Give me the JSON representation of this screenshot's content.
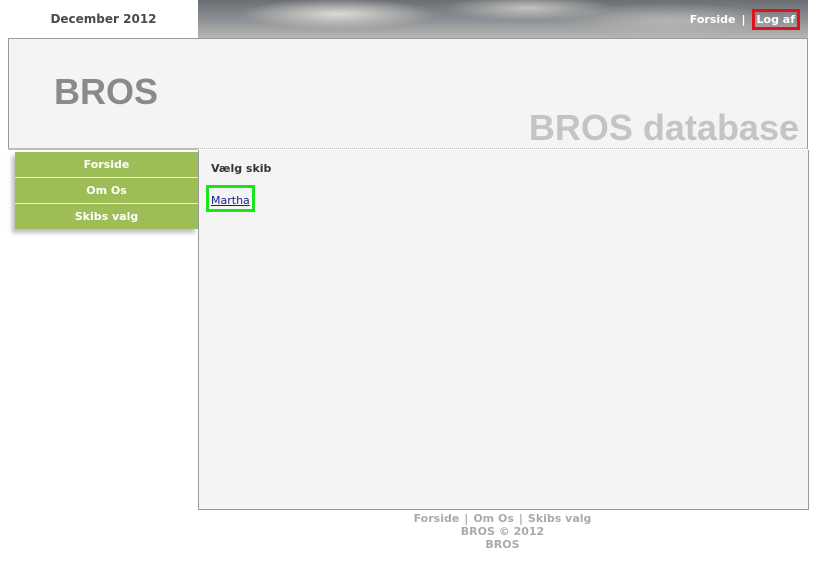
{
  "header": {
    "date": "December 2012",
    "logo": "BROS",
    "db_title": "BROS database"
  },
  "top_nav": {
    "home": "Forside",
    "separator": "|",
    "logout": "Log af"
  },
  "sidebar": {
    "items": [
      {
        "label": "Forside"
      },
      {
        "label": "Om Os"
      },
      {
        "label": "Skibs valg"
      }
    ]
  },
  "main": {
    "heading": "Vælg skib",
    "ship_link": "Martha"
  },
  "footer": {
    "links": [
      "Forside",
      "Om Os",
      "Skibs valg"
    ],
    "separator": "|",
    "copyright": "BROS © 2012",
    "name": "BROS"
  },
  "colors": {
    "sidebar_green": "#9dbd56",
    "logout_highlight": "#e3101a",
    "ship_highlight": "#19e619"
  }
}
